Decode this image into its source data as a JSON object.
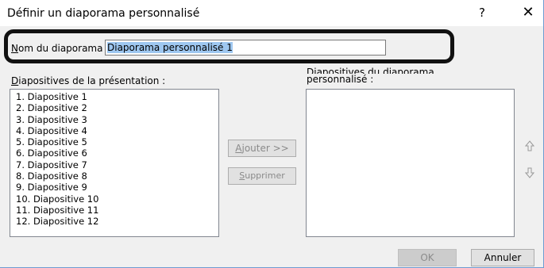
{
  "dialog": {
    "title": "Définir un diaporama personnalisé",
    "help_label": "?",
    "close_label": "✕"
  },
  "name_field": {
    "label_first": "N",
    "label_rest": "om du diaporama :",
    "value": "Diaporama personnalisé 1"
  },
  "left_list": {
    "label_first": "D",
    "label_rest": "iapositives de la présentation :",
    "items": [
      "1. Diapositive 1",
      "2. Diapositive 2",
      "3. Diapositive 3",
      "4. Diapositive 4",
      "5. Diapositive 5",
      "6. Diapositive 6",
      "7. Diapositive 7",
      "8. Diapositive 8",
      "9. Diapositive 9",
      "10. Diapositive 10",
      "11. Diapositive 11",
      "12. Diapositive 12"
    ]
  },
  "right_list": {
    "label_line1": "Diapositives du diaporama",
    "label_line2": "personnalisé :"
  },
  "buttons": {
    "add_first": "A",
    "add_rest": "jouter >>",
    "remove_first": "S",
    "remove_rest": "upprimer",
    "ok": "OK",
    "cancel": "Annuler"
  },
  "icons": {
    "move_up": "move-up-arrow-icon",
    "move_down": "move-down-arrow-icon"
  }
}
